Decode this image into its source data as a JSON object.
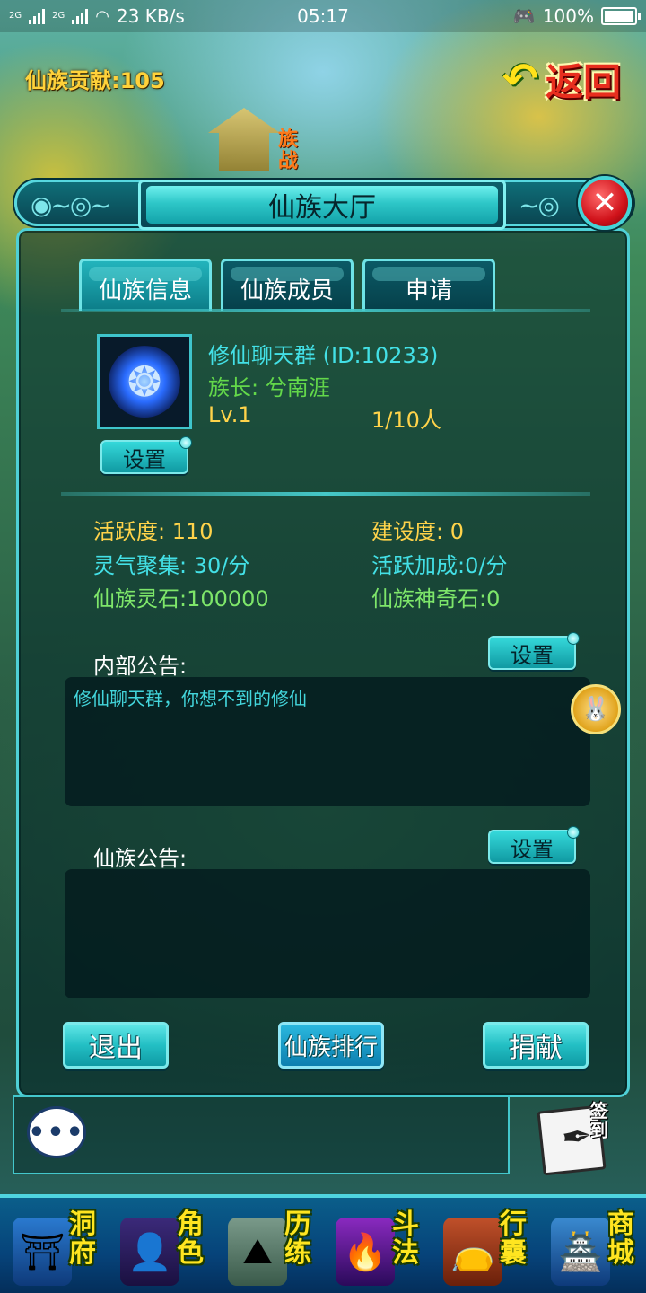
{
  "status_bar": {
    "network1": "2G",
    "network2": "2G",
    "speed": "23 KB/s",
    "time": "05:17",
    "battery": "100%",
    "icons": [
      "signal-icon",
      "wifi-icon",
      "gamepad-icon",
      "battery-icon"
    ]
  },
  "header": {
    "contribution": "仙族贡献:105",
    "back_label": "返回",
    "war_badge": "族战"
  },
  "panel": {
    "title": "仙族大厅",
    "tabs": [
      {
        "label": "仙族信息",
        "active": true
      },
      {
        "label": "仙族成员",
        "active": false
      },
      {
        "label": "申请",
        "active": false
      }
    ]
  },
  "clan": {
    "name": "修仙聊天群 (ID:10233)",
    "leader": "族长: 兮南涯",
    "level": "Lv.1",
    "members": "1/10人",
    "settings_label": "设置"
  },
  "stats": {
    "activity": "活跃度: 110",
    "construction": "建设度: 0",
    "aura": "灵气聚集: 30/分",
    "activity_bonus": "活跃加成:0/分",
    "spirit_stones": "仙族灵石:100000",
    "magic_stones": "仙族神奇石:0"
  },
  "internal_notice": {
    "label": "内部公告:",
    "settings_label": "设置",
    "content": "修仙聊天群，你想不到的修仙"
  },
  "clan_notice": {
    "label": "仙族公告:",
    "settings_label": "设置",
    "content": ""
  },
  "actions": {
    "quit": "退出",
    "ranking": "仙族排行",
    "donate": "捐献"
  },
  "chat": {
    "icon": "chat-bubble-icon",
    "checkin_label": "签到"
  },
  "bottom_nav": [
    {
      "label": "洞府",
      "icon": "cave-icon"
    },
    {
      "label": "角色",
      "icon": "character-icon"
    },
    {
      "label": "历练",
      "icon": "training-icon"
    },
    {
      "label": "斗法",
      "icon": "battle-icon"
    },
    {
      "label": "行囊",
      "icon": "bag-icon"
    },
    {
      "label": "商城",
      "icon": "shop-icon"
    }
  ],
  "colors": {
    "accent_cyan": "#43e0e6",
    "frame": "#4fd0d6",
    "gold": "#ffd34a",
    "green": "#63d84a",
    "close_red": "#d0121a"
  }
}
